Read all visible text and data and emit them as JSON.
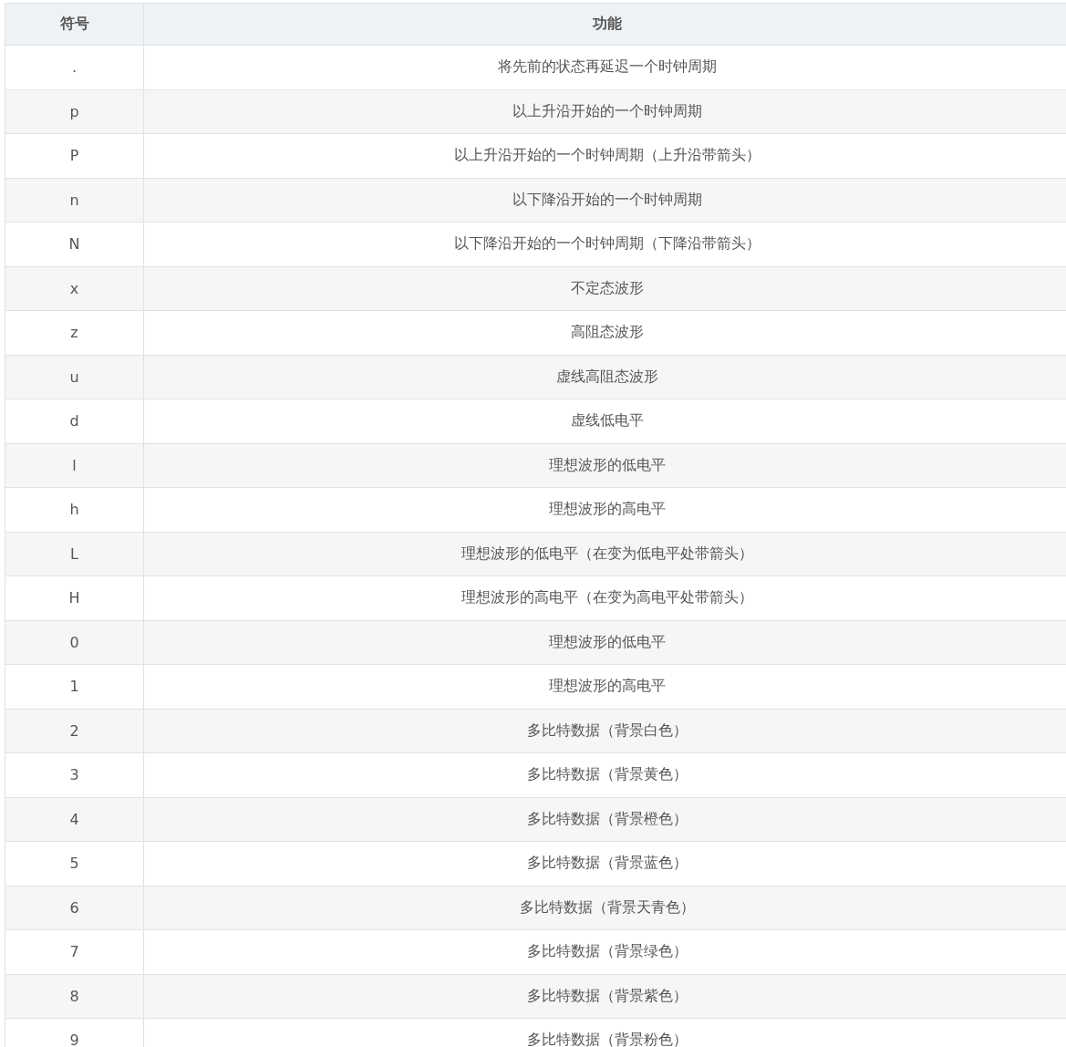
{
  "table": {
    "columns": [
      "符号",
      "功能"
    ],
    "rows": [
      [
        ".",
        "将先前的状态再延迟一个时钟周期"
      ],
      [
        "p",
        "以上升沿开始的一个时钟周期"
      ],
      [
        "P",
        "以上升沿开始的一个时钟周期（上升沿带箭头）"
      ],
      [
        "n",
        "以下降沿开始的一个时钟周期"
      ],
      [
        "N",
        "以下降沿开始的一个时钟周期（下降沿带箭头）"
      ],
      [
        "x",
        "不定态波形"
      ],
      [
        "z",
        "高阻态波形"
      ],
      [
        "u",
        "虚线高阻态波形"
      ],
      [
        "d",
        "虚线低电平"
      ],
      [
        "l",
        "理想波形的低电平"
      ],
      [
        "h",
        "理想波形的高电平"
      ],
      [
        "L",
        "理想波形的低电平（在变为低电平处带箭头）"
      ],
      [
        "H",
        "理想波形的高电平（在变为高电平处带箭头）"
      ],
      [
        "0",
        "理想波形的低电平"
      ],
      [
        "1",
        "理想波形的高电平"
      ],
      [
        "2",
        "多比特数据（背景白色）"
      ],
      [
        "3",
        "多比特数据（背景黄色）"
      ],
      [
        "4",
        "多比特数据（背景橙色）"
      ],
      [
        "5",
        "多比特数据（背景蓝色）"
      ],
      [
        "6",
        "多比特数据（背景天青色）"
      ],
      [
        "7",
        "多比特数据（背景绿色）"
      ],
      [
        "8",
        "多比特数据（背景紫色）"
      ],
      [
        "9",
        "多比特数据（背景粉色）"
      ]
    ]
  }
}
